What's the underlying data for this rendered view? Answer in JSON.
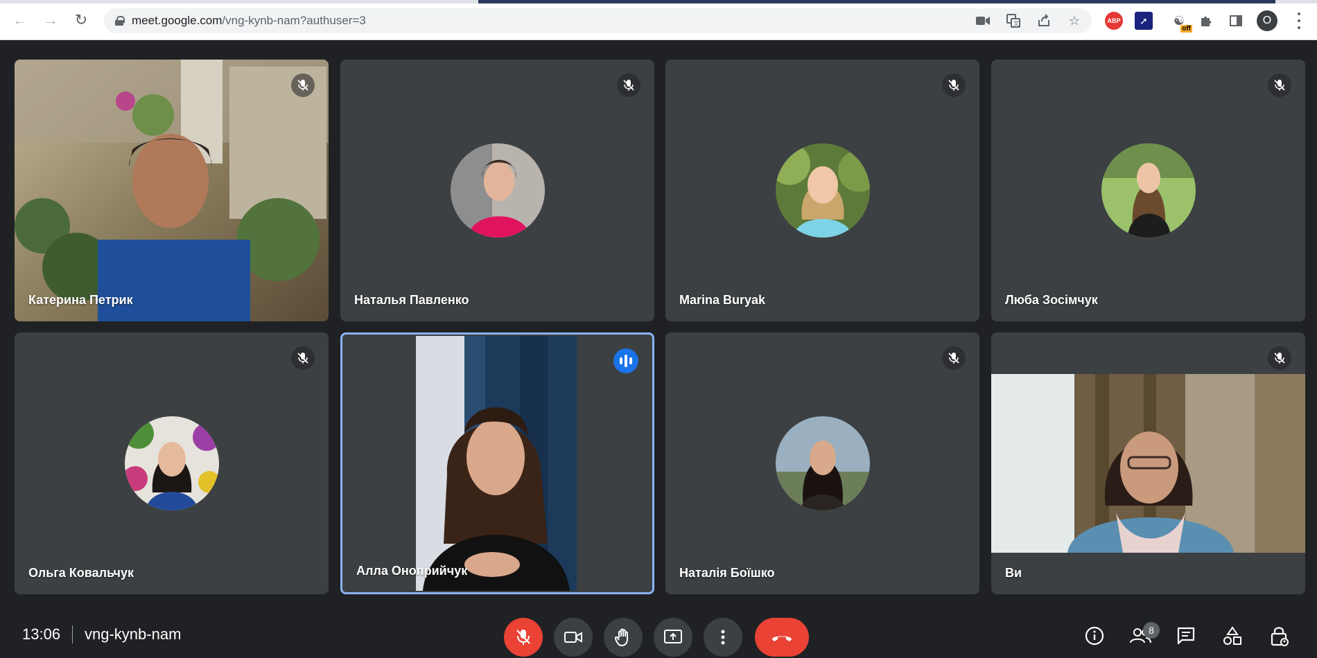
{
  "browser": {
    "url_host": "meet.google.com",
    "url_path": "/vng-kynb-nam?authuser=3",
    "extensions": {
      "abp_label": "ABP",
      "ghost_badge": "off"
    },
    "profile_initial": "O"
  },
  "participants": [
    {
      "name": "Катерина Петрик",
      "muted": true,
      "mode": "video"
    },
    {
      "name": "Наталья Павленко",
      "muted": true,
      "mode": "avatar"
    },
    {
      "name": "Marina Buryak",
      "muted": true,
      "mode": "avatar"
    },
    {
      "name": "Люба Зосімчук",
      "muted": true,
      "mode": "avatar"
    },
    {
      "name": "Ольга Ковальчук",
      "muted": true,
      "mode": "avatar"
    },
    {
      "name": "Алла Оноприйчук",
      "muted": false,
      "speaking": true,
      "mode": "video"
    },
    {
      "name": "Наталія Боїшко",
      "muted": true,
      "mode": "avatar"
    },
    {
      "name": "Ви",
      "muted": true,
      "mode": "video"
    }
  ],
  "meeting": {
    "time": "13:06",
    "code": "vng-kynb-nam",
    "participant_count": "8"
  },
  "colors": {
    "background": "#202124",
    "tile": "#3c4043",
    "accent_blue": "#1a73e8",
    "speaking_border": "#8ab4f8",
    "danger_red": "#ea4335"
  }
}
